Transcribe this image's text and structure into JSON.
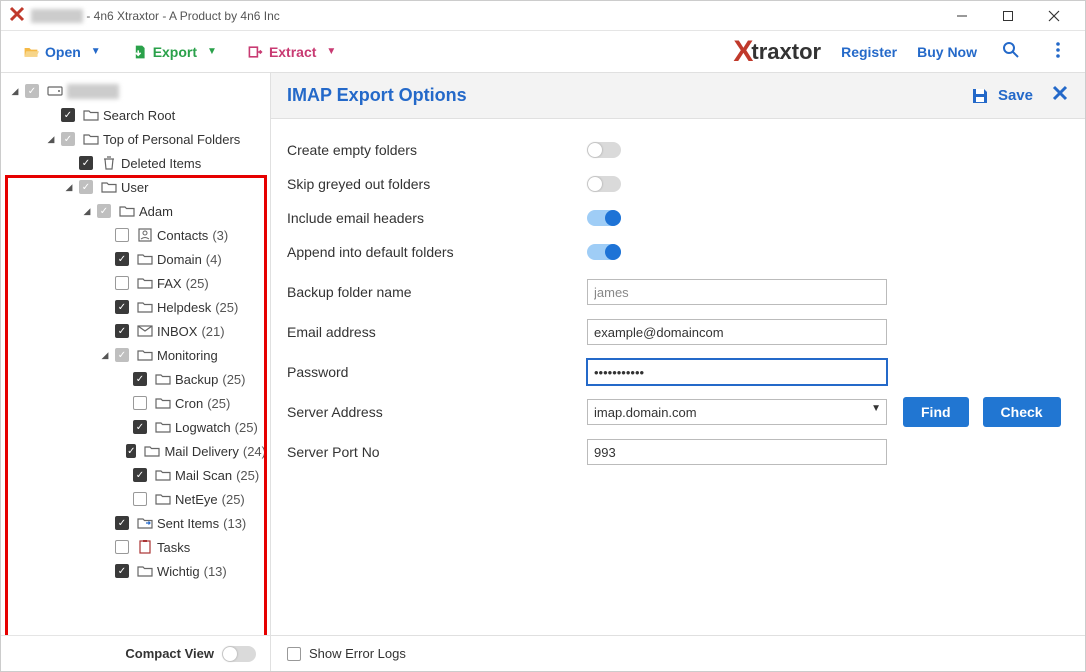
{
  "window": {
    "title_suffix": " - 4n6 Xtraxtor - A Product by 4n6 Inc"
  },
  "toolbar": {
    "open": "Open",
    "export": "Export",
    "extract": "Extract",
    "register": "Register",
    "buy": "Buy Now",
    "brand": "traxtor"
  },
  "tree": [
    {
      "d": 0,
      "tw": "▼",
      "cb": "dim",
      "icon": "drive",
      "label": "",
      "blur": true,
      "count": ""
    },
    {
      "d": 2,
      "tw": "",
      "cb": "checked",
      "icon": "folder",
      "label": "Search Root",
      "count": ""
    },
    {
      "d": 2,
      "tw": "▼",
      "cb": "dim",
      "icon": "folder",
      "label": "Top of Personal Folders",
      "count": ""
    },
    {
      "d": 3,
      "tw": "",
      "cb": "checked",
      "icon": "trash",
      "label": "Deleted Items",
      "count": ""
    },
    {
      "d": 3,
      "tw": "▼",
      "cb": "dim",
      "icon": "folder",
      "label": "User",
      "count": ""
    },
    {
      "d": 4,
      "tw": "▼",
      "cb": "dim",
      "icon": "folder",
      "label": "Adam",
      "count": ""
    },
    {
      "d": 5,
      "tw": "",
      "cb": "",
      "icon": "contacts",
      "label": "Contacts",
      "count": "(3)"
    },
    {
      "d": 5,
      "tw": "",
      "cb": "checked",
      "icon": "folder",
      "label": "Domain",
      "count": "(4)"
    },
    {
      "d": 5,
      "tw": "",
      "cb": "",
      "icon": "folder",
      "label": "FAX",
      "count": "(25)"
    },
    {
      "d": 5,
      "tw": "",
      "cb": "checked",
      "icon": "folder",
      "label": "Helpdesk",
      "count": "(25)"
    },
    {
      "d": 5,
      "tw": "",
      "cb": "checked",
      "icon": "mail",
      "label": "INBOX",
      "count": "(21)"
    },
    {
      "d": 5,
      "tw": "▼",
      "cb": "dim",
      "icon": "folder",
      "label": "Monitoring",
      "count": ""
    },
    {
      "d": 6,
      "tw": "",
      "cb": "checked",
      "icon": "folder",
      "label": "Backup",
      "count": "(25)"
    },
    {
      "d": 6,
      "tw": "",
      "cb": "",
      "icon": "folder",
      "label": "Cron",
      "count": "(25)"
    },
    {
      "d": 6,
      "tw": "",
      "cb": "checked",
      "icon": "folder",
      "label": "Logwatch",
      "count": "(25)"
    },
    {
      "d": 6,
      "tw": "",
      "cb": "checked",
      "icon": "folder",
      "label": "Mail Delivery",
      "count": "(24)"
    },
    {
      "d": 6,
      "tw": "",
      "cb": "checked",
      "icon": "folder",
      "label": "Mail Scan",
      "count": "(25)"
    },
    {
      "d": 6,
      "tw": "",
      "cb": "",
      "icon": "folder",
      "label": "NetEye",
      "count": "(25)"
    },
    {
      "d": 5,
      "tw": "",
      "cb": "checked",
      "icon": "sent",
      "label": "Sent Items",
      "count": "(13)"
    },
    {
      "d": 5,
      "tw": "",
      "cb": "",
      "icon": "tasks",
      "label": "Tasks",
      "count": ""
    },
    {
      "d": 5,
      "tw": "",
      "cb": "checked",
      "icon": "folder",
      "label": "Wichtig",
      "count": "(13)"
    }
  ],
  "compact": "Compact View",
  "panel": {
    "title": "IMAP Export Options",
    "save": "Save"
  },
  "form": {
    "r1": {
      "label": "Create empty folders",
      "on": false
    },
    "r2": {
      "label": "Skip greyed out folders",
      "on": false
    },
    "r3": {
      "label": "Include email headers",
      "on": true
    },
    "r4": {
      "label": "Append into default folders",
      "on": true
    },
    "r5": {
      "label": "Backup folder name",
      "placeholder": "james",
      "value": ""
    },
    "r6": {
      "label": "Email address",
      "value": "example@domaincom"
    },
    "r7": {
      "label": "Password",
      "value": "•••••••••••"
    },
    "r8": {
      "label": "Server Address",
      "value": "imap.domain.com"
    },
    "r9": {
      "label": "Server Port No",
      "value": "993"
    },
    "find": "Find",
    "check": "Check"
  },
  "footer": {
    "errlogs": "Show Error Logs"
  }
}
